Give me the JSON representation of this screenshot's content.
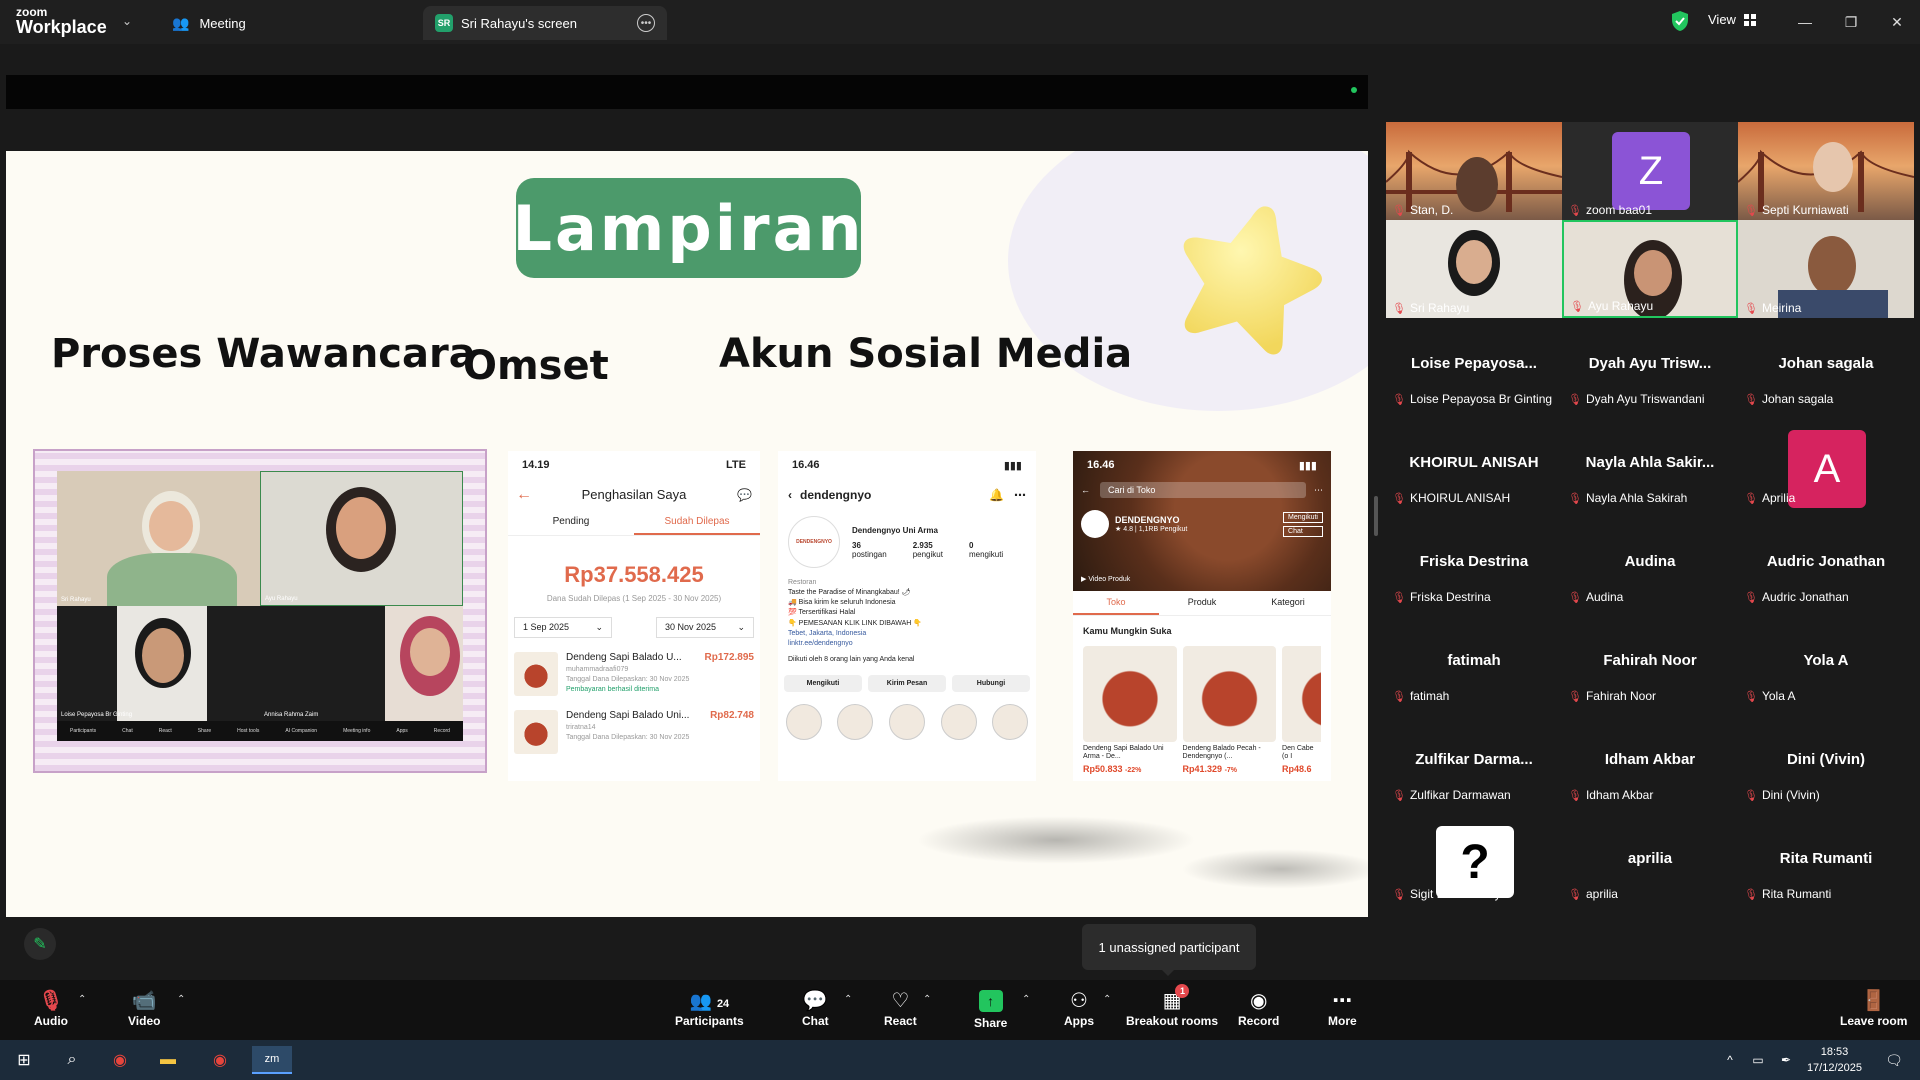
{
  "app": {
    "brand_top": "zoom",
    "brand_bottom": "Workplace",
    "tab_meeting": "Meeting",
    "tab_screen": "Sri Rahayu's screen",
    "tab_screen_badge": "SR",
    "view_label": "View"
  },
  "slide": {
    "title": "Lampiran",
    "heading_interview": "Proses Wawancara",
    "heading_omset": "Omset",
    "heading_social": "Akun Sosial Media",
    "zoom_tiles": [
      "Sri Rahayu",
      "Ayu Rahayu",
      "Loise Pepayosa Br Ginting",
      "Annisa Rahma Zaim"
    ],
    "zoom_toolbar": [
      "Participants",
      "Chat",
      "React",
      "Share",
      "Host tools",
      "AI Companion",
      "Meeting info",
      "Apps",
      "Record"
    ],
    "omset": {
      "time": "14.19",
      "signal": "LTE",
      "title": "Penghasilan Saya",
      "tab_pending": "Pending",
      "tab_released": "Sudah Dilepas",
      "amount": "Rp37.558.425",
      "amount_sub": "Dana Sudah Dilepas (1 Sep 2025 - 30 Nov 2025)",
      "date_from": "1 Sep 2025",
      "date_to": "30 Nov 2025",
      "orders": [
        {
          "name": "Dendeng Sapi Balado U...",
          "price": "Rp172.895",
          "user": "muhammadraafi079",
          "date": "Tanggal Dana Dilepaskan: 30 Nov 2025",
          "status": "Pembayaran berhasil diterima",
          "thumb": "1 produk"
        },
        {
          "name": "Dendeng Sapi Balado Uni...",
          "price": "Rp82.748",
          "user": "triratna14",
          "date": "Tanggal Dana Dilepaskan: 30 Nov 2025",
          "status": "",
          "thumb": ""
        }
      ]
    },
    "instagram": {
      "time": "16.46",
      "username": "dendengnyo",
      "display_name": "Dendengnyo Uni Arma",
      "posts_num": "36",
      "posts_label": "postingan",
      "followers_num": "2.935",
      "followers_label": "pengikut",
      "following_num": "0",
      "following_label": "mengikuti",
      "category": "Restoran",
      "bio1": "Taste the Paradise of Minangkabau! 🌶",
      "bio2": "🚚 Bisa kirim ke seluruh Indonesia",
      "bio3": "💯 Tersertifikasi Halal",
      "bio4": "👇 PEMESANAN KLIK LINK DIBAWAH 👇",
      "location": "Tebet, Jakarta, Indonesia",
      "link": "linktr.ee/dendengnyo",
      "followed_by": "Diikuti oleh 8 orang lain yang Anda kenal",
      "btn_following": "Mengikuti",
      "btn_message": "Kirim Pesan",
      "btn_contact": "Hubungi",
      "logo_text": "DENDENGNYO"
    },
    "shop": {
      "time": "16.46",
      "search_placeholder": "Cari di Toko",
      "shop_name": "DENDENGNYO",
      "rating": "4.8",
      "followers": "1,1RB Pengikut",
      "follow_btn": "Mengikuti",
      "chat_btn": "Chat",
      "video_label": "Video Produk",
      "tab_shop": "Toko",
      "tab_product": "Produk",
      "tab_category": "Kategori",
      "section": "Kamu Mungkin Suka",
      "products": [
        {
          "title": "Dendeng Sapi Balado Uni Arma - De...",
          "price": "Rp50.833",
          "disc": "-22%"
        },
        {
          "title": "Dendeng Balado Pecah - Dendengnyo (...",
          "price": "Rp41.329",
          "disc": "-7%"
        },
        {
          "title": "Den Cabe (o I",
          "price": "Rp48.6",
          "disc": ""
        }
      ]
    }
  },
  "gallery": {
    "video_tiles": [
      {
        "name": "Stan, D."
      },
      {
        "name": "zoom baa01",
        "initial": "Z"
      },
      {
        "name": "Septi Kurniawati"
      },
      {
        "name": "Sri Rahayu"
      },
      {
        "name": "Ayu Rahayu"
      },
      {
        "name": "Meirina"
      }
    ],
    "participants": [
      {
        "big": "Loise Pepayosa...",
        "small": "Loise Pepayosa Br Ginting"
      },
      {
        "big": "Dyah Ayu Trisw...",
        "small": "Dyah Ayu Triswandani"
      },
      {
        "big": "Johan sagala",
        "small": "Johan sagala"
      },
      {
        "big": "KHOIRUL ANISAH",
        "small": "KHOIRUL ANISAH"
      },
      {
        "big": "Nayla Ahla Sakir...",
        "small": "Nayla Ahla Sakirah"
      },
      {
        "big": "",
        "small": "Aprilia",
        "initial": "A"
      },
      {
        "big": "Friska Destrina",
        "small": "Friska Destrina"
      },
      {
        "big": "Audina",
        "small": "Audina"
      },
      {
        "big": "Audric Jonathan",
        "small": "Audric Jonathan"
      },
      {
        "big": "fatimah",
        "small": "fatimah"
      },
      {
        "big": "Fahirah Noor",
        "small": "Fahirah Noor"
      },
      {
        "big": "Yola A",
        "small": "Yola A"
      },
      {
        "big": "Zulfikar  Darma...",
        "small": "Zulfikar Darmawan"
      },
      {
        "big": "Idham Akbar",
        "small": "Idham Akbar"
      },
      {
        "big": "Dini (Vivin)",
        "small": "Dini (Vivin)"
      },
      {
        "big": "",
        "small": "Sigit Dwi Prasetyo"
      },
      {
        "big": "aprilia",
        "small": "aprilia"
      },
      {
        "big": "Rita Rumanti",
        "small": "Rita Rumanti"
      }
    ]
  },
  "tooltip": "1 unassigned participant",
  "toolbar": {
    "audio": "Audio",
    "video": "Video",
    "participants": "Participants",
    "participants_count": "24",
    "chat": "Chat",
    "react": "React",
    "share": "Share",
    "apps": "Apps",
    "breakout": "Breakout rooms",
    "breakout_badge": "1",
    "record": "Record",
    "more": "More",
    "leave": "Leave room"
  },
  "taskbar": {
    "time": "18:53",
    "date": "17/12/2025"
  },
  "colors": {
    "accent_green": "#22c55e",
    "slide_title_bg": "#4c9a6b",
    "shopee_orange": "#e06a4c",
    "muted_red": "#e5484d"
  }
}
